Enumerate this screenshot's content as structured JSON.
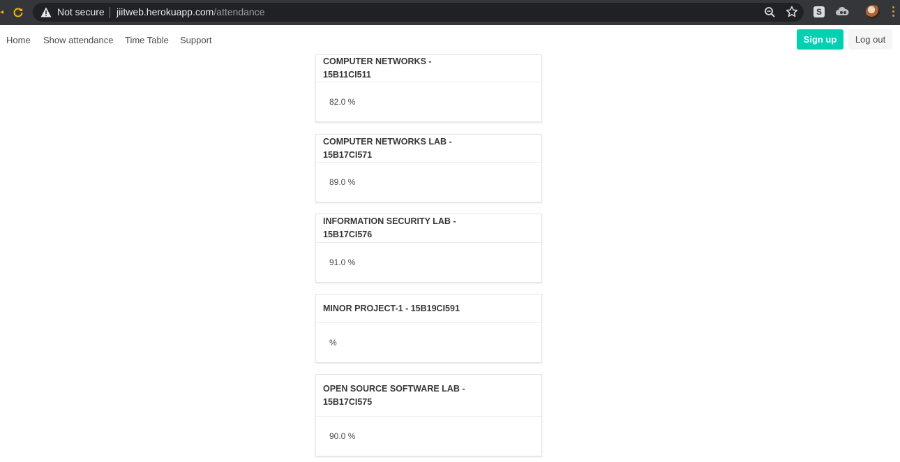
{
  "browser": {
    "security_label": "Not secure",
    "url_host": "jiitweb.herokuapp.com",
    "url_path": "/attendance",
    "extension_letter": "S"
  },
  "nav": {
    "links": [
      "Home",
      "Show attendance",
      "Time Table",
      "Support"
    ],
    "signup_label": "Sign up",
    "logout_label": "Log out"
  },
  "courses": [
    {
      "title": "COMPUTER NETWORKS - 15B11CI511",
      "attendance": "82.0 %"
    },
    {
      "title": "COMPUTER NETWORKS LAB - 15B17CI571",
      "attendance": "89.0 %"
    },
    {
      "title": "INFORMATION SECURITY LAB - 15B17CI576",
      "attendance": "91.0 %"
    },
    {
      "title": "MINOR PROJECT-1 - 15B19CI591",
      "attendance": "%"
    },
    {
      "title": "OPEN SOURCE SOFTWARE LAB - 15B17CI575",
      "attendance": "90.0 %"
    }
  ],
  "colors": {
    "chrome_bg": "#35363a",
    "omnibox_bg": "#202124",
    "signup_bg": "#00d1b2",
    "logout_bg": "#f5f5f5"
  }
}
